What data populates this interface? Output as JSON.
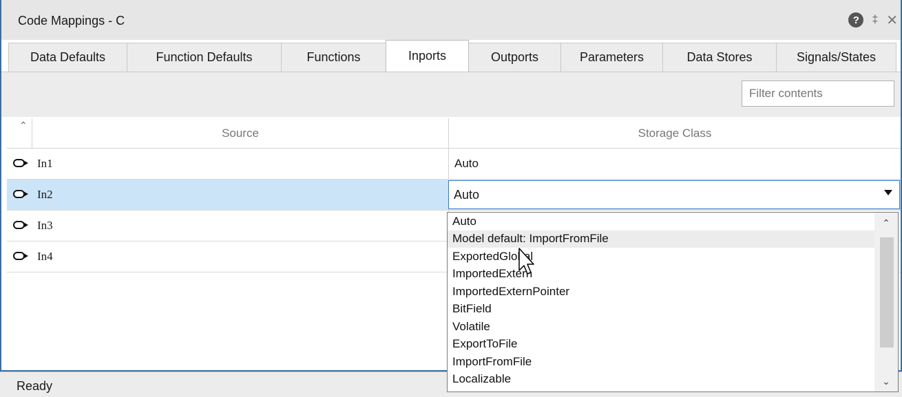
{
  "window": {
    "title": "Code Mappings - C",
    "help_icon_glyph": "?",
    "pin_icon_glyph": "‡",
    "close_icon_glyph": "✕"
  },
  "tabs": [
    {
      "label": "Data Defaults"
    },
    {
      "label": "Function Defaults"
    },
    {
      "label": "Functions"
    },
    {
      "label": "Inports"
    },
    {
      "label": "Outports"
    },
    {
      "label": "Parameters"
    },
    {
      "label": "Data Stores"
    },
    {
      "label": "Signals/States"
    }
  ],
  "active_tab": "Inports",
  "filter": {
    "placeholder": "Filter contents",
    "value": ""
  },
  "table": {
    "columns": [
      "Source",
      "Storage Class"
    ],
    "rows": [
      {
        "source": "In1",
        "storage_class": "Auto"
      },
      {
        "source": "In2",
        "storage_class": "Auto"
      },
      {
        "source": "In3",
        "storage_class": ""
      },
      {
        "source": "In4",
        "storage_class": ""
      }
    ],
    "selected_row": "In2"
  },
  "dropdown": {
    "options": [
      "Auto",
      "Model default: ImportFromFile",
      "ExportedGlobal",
      "ImportedExtern",
      "ImportedExternPointer",
      "BitField",
      "Volatile",
      "ExportToFile",
      "ImportFromFile",
      "Localizable"
    ],
    "hovered_option": "Model default: ImportFromFile"
  },
  "status": {
    "text": "Ready"
  },
  "colors": {
    "selection": "#cce4f7",
    "panel_border": "#3a6ea5",
    "focus_border": "#3a78c3"
  }
}
